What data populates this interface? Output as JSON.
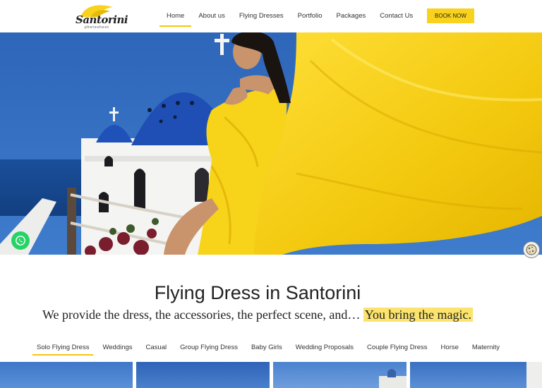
{
  "brand": {
    "name": "Santorini",
    "tagline": "photoshoot"
  },
  "nav": {
    "items": [
      {
        "label": "Home",
        "active": true
      },
      {
        "label": "About us"
      },
      {
        "label": "Flying Dresses"
      },
      {
        "label": "Portfolio"
      },
      {
        "label": "Packages"
      },
      {
        "label": "Contact Us"
      }
    ],
    "cta": "BOOK NOW"
  },
  "intro": {
    "title": "Flying Dress in Santorini",
    "subtitle": "We provide the dress, the accessories, the perfect scene, and…",
    "highlight": "You bring the magic."
  },
  "categories": [
    "Solo Flying Dress",
    "Weddings",
    "Casual",
    "Group Flying Dress",
    "Baby Girls",
    "Wedding Proposals",
    "Couple Flying Dress",
    "Horse",
    "Maternity"
  ],
  "icons": {
    "whatsapp": "whatsapp-icon",
    "cookie": "cookie-icon"
  },
  "colors": {
    "accent": "#f8d21d",
    "whatsapp": "#25d366",
    "dome": "#1f4fb5",
    "dress": "#f7d31a"
  }
}
